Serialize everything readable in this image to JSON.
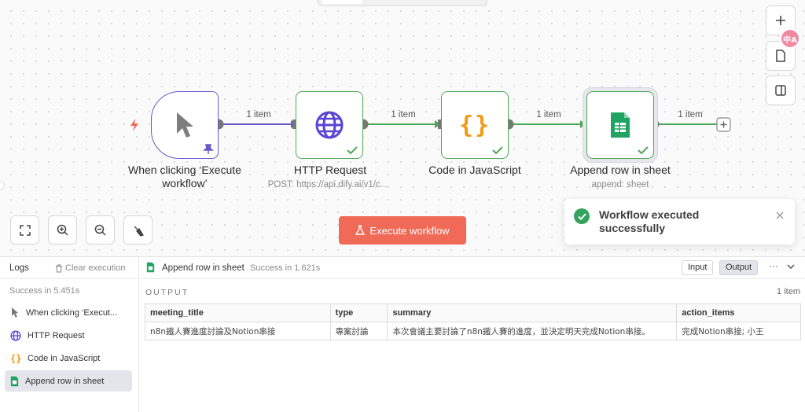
{
  "canvas": {
    "nodes": [
      {
        "title": "When clicking ‘Execute workflow’",
        "subtitle": "",
        "icon": "cursor-icon",
        "kind": "trigger"
      },
      {
        "title": "HTTP Request",
        "subtitle": "POST: https://api.dify.ai/v1/c...",
        "icon": "globe-icon",
        "kind": "action"
      },
      {
        "title": "Code in JavaScript",
        "subtitle": "",
        "icon": "braces-icon",
        "kind": "action"
      },
      {
        "title": "Append row in sheet",
        "subtitle": "append: sheet",
        "icon": "google-sheets-icon",
        "kind": "action"
      }
    ],
    "edge_labels": [
      "1 item",
      "1 item",
      "1 item",
      "1 item"
    ],
    "execute_button": "Execute workflow",
    "translate_badge": "中A"
  },
  "toast": {
    "message_line1": "Workflow executed",
    "message_line2": "successfully"
  },
  "logs": {
    "title": "Logs",
    "clear_label": "Clear execution",
    "success_text": "Success in 5.451s",
    "items": [
      {
        "label": "When clicking ‘Execut...",
        "icon": "cursor-icon"
      },
      {
        "label": "HTTP Request",
        "icon": "globe-icon"
      },
      {
        "label": "Code in JavaScript",
        "icon": "braces-icon"
      },
      {
        "label": "Append row in sheet",
        "icon": "google-sheets-icon",
        "active": true
      }
    ]
  },
  "detail": {
    "title": "Append row in sheet",
    "status": "Success in 1.621s",
    "input_label": "Input",
    "output_label": "Output",
    "more": "···",
    "section_label": "OUTPUT",
    "item_count": "1 item",
    "columns": [
      "meeting_title",
      "type",
      "summary",
      "action_items"
    ],
    "rows": [
      [
        "n8n鐵人賽進度討論及Notion串接",
        "專案討論",
        "本次會議主要討論了n8n鐵人賽的進度，並決定明天完成Notion串接。",
        "完成Notion串接; 小王"
      ]
    ]
  },
  "colors": {
    "accent": "#f06a57",
    "success": "#4ca856",
    "trigger": "#6b57c9",
    "http": "#5a44d6",
    "code": "#f29a14",
    "sheets": "#1fa463"
  }
}
